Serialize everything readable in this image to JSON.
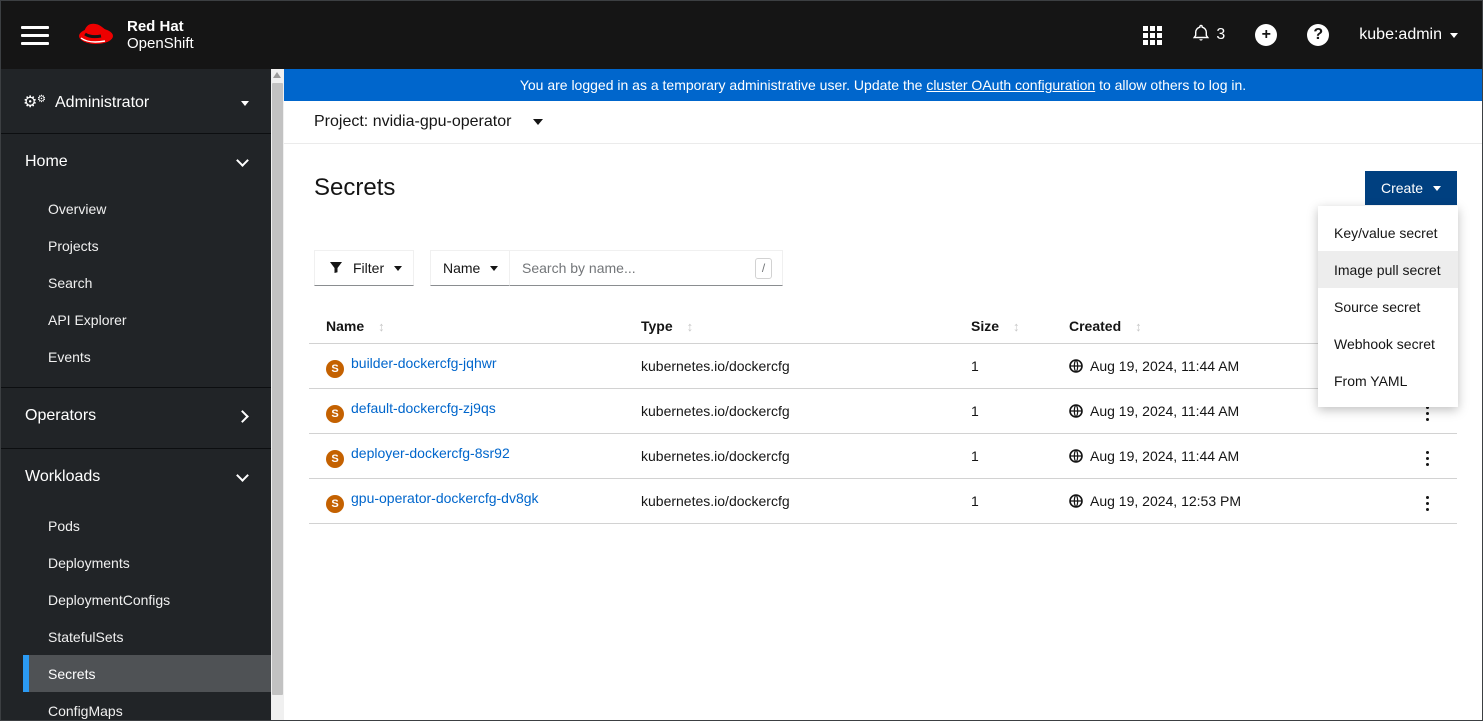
{
  "masthead": {
    "brand_line1": "Red Hat",
    "brand_line2": "OpenShift",
    "notification_count": "3",
    "username": "kube:admin"
  },
  "banner": {
    "text_before": "You are logged in as a temporary administrative user. Update the ",
    "link_text": "cluster OAuth configuration",
    "text_after": " to allow others to log in."
  },
  "project_bar": {
    "label": "Project: nvidia-gpu-operator"
  },
  "sidebar": {
    "perspective": "Administrator",
    "home": {
      "label": "Home",
      "items": [
        "Overview",
        "Projects",
        "Search",
        "API Explorer",
        "Events"
      ]
    },
    "operators": {
      "label": "Operators"
    },
    "workloads": {
      "label": "Workloads",
      "items": [
        "Pods",
        "Deployments",
        "DeploymentConfigs",
        "StatefulSets",
        "Secrets",
        "ConfigMaps"
      ],
      "active_item": "Secrets"
    }
  },
  "page": {
    "title": "Secrets",
    "create_button": "Create",
    "create_menu": {
      "items": [
        "Key/value secret",
        "Image pull secret",
        "Source secret",
        "Webhook secret",
        "From YAML"
      ],
      "highlighted": "Image pull secret"
    }
  },
  "toolbar": {
    "filter_label": "Filter",
    "attribute_label": "Name",
    "search_placeholder": "Search by name...",
    "shortcut_hint": "/"
  },
  "table": {
    "badge_letter": "S",
    "headers": [
      "Name",
      "Type",
      "Size",
      "Created"
    ],
    "rows": [
      {
        "name": "builder-dockercfg-jqhwr",
        "type": "kubernetes.io/dockercfg",
        "size": "1",
        "created": "Aug 19, 2024, 11:44 AM"
      },
      {
        "name": "default-dockercfg-zj9qs",
        "type": "kubernetes.io/dockercfg",
        "size": "1",
        "created": "Aug 19, 2024, 11:44 AM"
      },
      {
        "name": "deployer-dockercfg-8sr92",
        "type": "kubernetes.io/dockercfg",
        "size": "1",
        "created": "Aug 19, 2024, 11:44 AM"
      },
      {
        "name": "gpu-operator-dockercfg-dv8gk",
        "type": "kubernetes.io/dockercfg",
        "size": "1",
        "created": "Aug 19, 2024, 12:53 PM"
      }
    ]
  },
  "colors": {
    "masthead_bg": "#151515",
    "sidebar_bg": "#212427",
    "banner_blue": "#0066cc",
    "primary_button_blue": "#004080",
    "link_blue": "#0066cc",
    "secret_badge_orange": "#c46100",
    "nav_active_bg": "#4f5255",
    "nav_active_border_blue": "#2b9af3"
  }
}
